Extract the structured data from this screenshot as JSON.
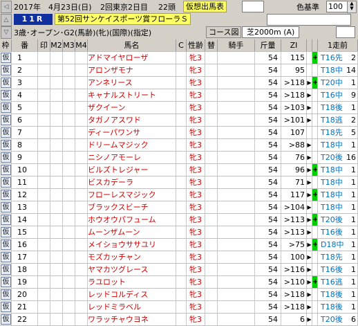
{
  "header": {
    "date": "2017年　4月23日(日)",
    "meeting": "2回東京2日目",
    "count": "22頭",
    "mode_label": "仮想出馬表",
    "base_label": "色基準",
    "base_value": "100",
    "race_no": "11R",
    "race_name": "第52回サンケイスポーツ賞フローラＳ",
    "conditions": "3歳･オープン･G2(馬齢)(牝)(国際)(指定)",
    "course_button": "コース図",
    "course_value": "芝2000m (A)"
  },
  "columns": {
    "waku": "枠",
    "ban": "番",
    "m1": "印",
    "m2": "M2",
    "m3": "M3",
    "m4": "M4",
    "name": "馬名",
    "c": "C",
    "sex": "性齢",
    "kae": "替",
    "jockey": "騎手",
    "weight": "斤量",
    "zi": "ZI",
    "last": "1走前"
  },
  "rows": [
    {
      "waku": "仮",
      "ban": "1",
      "name": "アドマイヤローザ",
      "sex": "牝3",
      "wt": "54",
      "zi": "115",
      "arrow": "",
      "mark": "+",
      "last_pos": "T16先",
      "last_rank": "2"
    },
    {
      "waku": "仮",
      "ban": "2",
      "name": "アロンザモナ",
      "sex": "牝3",
      "wt": "54",
      "zi": "95",
      "arrow": "",
      "mark": "",
      "last_pos": "T18中",
      "last_rank": "14"
    },
    {
      "waku": "仮",
      "ban": "3",
      "name": "アンネリース",
      "sex": "牝3",
      "wt": "54",
      "zi": ">118",
      "arrow": "▶",
      "mark": "+",
      "last_pos": "T20中",
      "last_rank": "1"
    },
    {
      "waku": "仮",
      "ban": "4",
      "name": "キャナルストリート",
      "sex": "牝3",
      "wt": "54",
      "zi": ">118",
      "arrow": "▶",
      "mark": "",
      "last_pos": "T16中",
      "last_rank": "9"
    },
    {
      "waku": "仮",
      "ban": "5",
      "name": "ザクイーン",
      "sex": "牝3",
      "wt": "54",
      "zi": ">103",
      "arrow": "▶",
      "mark": "",
      "last_pos": "T18後",
      "last_rank": "1"
    },
    {
      "waku": "仮",
      "ban": "6",
      "name": "タガノアスワド",
      "sex": "牝3",
      "wt": "54",
      "zi": ">101",
      "arrow": "▶",
      "mark": "",
      "last_pos": "T18逃",
      "last_rank": "2"
    },
    {
      "waku": "仮",
      "ban": "7",
      "name": "ディーパワンサ",
      "sex": "牝3",
      "wt": "54",
      "zi": "107",
      "arrow": "",
      "mark": "",
      "last_pos": "T18先",
      "last_rank": "5"
    },
    {
      "waku": "仮",
      "ban": "8",
      "name": "ドリームマジック",
      "sex": "牝3",
      "wt": "54",
      "zi": ">88",
      "arrow": "▶",
      "mark": "",
      "last_pos": "T18中",
      "last_rank": "1"
    },
    {
      "waku": "仮",
      "ban": "9",
      "name": "ニシノアモーレ",
      "sex": "牝3",
      "wt": "54",
      "zi": "76",
      "arrow": "▶",
      "mark": "",
      "last_pos": "T20後",
      "last_rank": "16"
    },
    {
      "waku": "仮",
      "ban": "10",
      "name": "ビルズトレジャー",
      "sex": "牝3",
      "wt": "54",
      "zi": "96",
      "arrow": "▶",
      "mark": "+",
      "last_pos": "T18中",
      "last_rank": "1"
    },
    {
      "waku": "仮",
      "ban": "11",
      "name": "ビスカデーラ",
      "sex": "牝3",
      "wt": "54",
      "zi": "71",
      "arrow": "▶",
      "mark": "",
      "last_pos": "T18中",
      "last_rank": "1"
    },
    {
      "waku": "仮",
      "ban": "12",
      "name": "フローレスマジック",
      "sex": "牝3",
      "wt": "54",
      "zi": "117",
      "arrow": "▶",
      "mark": "+",
      "last_pos": "T18中",
      "last_rank": "1"
    },
    {
      "waku": "仮",
      "ban": "13",
      "name": "ブラックスビーチ",
      "sex": "牝3",
      "wt": "54",
      "zi": ">104",
      "arrow": "▶",
      "mark": "",
      "last_pos": "T18中",
      "last_rank": "1"
    },
    {
      "waku": "仮",
      "ban": "14",
      "name": "ホウオウパフューム",
      "sex": "牝3",
      "wt": "54",
      "zi": ">113",
      "arrow": "▶",
      "mark": "+",
      "last_pos": "T20後",
      "last_rank": "1"
    },
    {
      "waku": "仮",
      "ban": "15",
      "name": "ムーンザムーン",
      "sex": "牝3",
      "wt": "54",
      "zi": ">113",
      "arrow": "▶",
      "mark": "",
      "last_pos": "T16後",
      "last_rank": "1"
    },
    {
      "waku": "仮",
      "ban": "16",
      "name": "メイショウササユリ",
      "sex": "牝3",
      "wt": "54",
      "zi": ">75",
      "arrow": "▶",
      "mark": "+",
      "last_pos": "D18中",
      "last_rank": "1"
    },
    {
      "waku": "仮",
      "ban": "17",
      "name": "モズカッチャン",
      "sex": "牝3",
      "wt": "54",
      "zi": "100",
      "arrow": "▶",
      "mark": "",
      "last_pos": "T18先",
      "last_rank": "1"
    },
    {
      "waku": "仮",
      "ban": "18",
      "name": "ヤマカツグレース",
      "sex": "牝3",
      "wt": "54",
      "zi": ">116",
      "arrow": "▶",
      "mark": "",
      "last_pos": "T16後",
      "last_rank": "1"
    },
    {
      "waku": "仮",
      "ban": "19",
      "name": "ラユロット",
      "sex": "牝3",
      "wt": "54",
      "zi": ">110",
      "arrow": "▶",
      "mark": "+",
      "last_pos": "T16逃",
      "last_rank": "1"
    },
    {
      "waku": "仮",
      "ban": "20",
      "name": "レッドコルディス",
      "sex": "牝3",
      "wt": "54",
      "zi": ">118",
      "arrow": "▶",
      "mark": "",
      "last_pos": "T18後",
      "last_rank": "1"
    },
    {
      "waku": "仮",
      "ban": "21",
      "name": "レッドミラベル",
      "sex": "牝3",
      "wt": "54",
      "zi": ">118",
      "arrow": "▶",
      "mark": "",
      "last_pos": "T18後",
      "last_rank": "1"
    },
    {
      "waku": "仮",
      "ban": "22",
      "name": "ワラッチャウヨネ",
      "sex": "牝3",
      "wt": "54",
      "zi": "6",
      "arrow": "▶",
      "mark": "",
      "last_pos": "T20後",
      "last_rank": "6"
    }
  ]
}
